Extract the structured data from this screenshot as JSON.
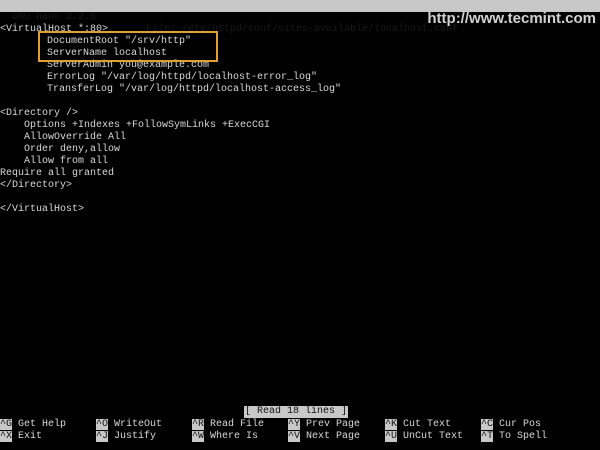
{
  "titlebar": {
    "app": "GNU nano 2.2.6",
    "file": "File: /etc/httpd/conf/sites-available/localhost.conf"
  },
  "watermark": "http://www.tecmint.com",
  "lines": [
    "<VirtualHost *:80>",
    "DocumentRoot \"/srv/http\"",
    "ServerName localhost",
    "ServerAdmin you@example.com",
    "ErrorLog \"/var/log/httpd/localhost-error_log\"",
    "TransferLog \"/var/log/httpd/localhost-access_log\"",
    "<Directory />",
    "Options +Indexes +FollowSymLinks +ExecCGI",
    "AllowOverride All",
    "Order deny,allow",
    "Allow from all",
    "Require all granted",
    "</Directory>",
    "</VirtualHost>"
  ],
  "status": "[ Read 18 lines ]",
  "shortcuts": [
    {
      "key": "^G",
      "label": "Get Help"
    },
    {
      "key": "^O",
      "label": "WriteOut"
    },
    {
      "key": "^R",
      "label": "Read File"
    },
    {
      "key": "^Y",
      "label": "Prev Page"
    },
    {
      "key": "^K",
      "label": "Cut Text"
    },
    {
      "key": "^C",
      "label": "Cur Pos"
    },
    {
      "key": "^X",
      "label": "Exit"
    },
    {
      "key": "^J",
      "label": "Justify"
    },
    {
      "key": "^W",
      "label": "Where Is"
    },
    {
      "key": "^V",
      "label": "Next Page"
    },
    {
      "key": "^U",
      "label": "UnCut Text"
    },
    {
      "key": "^T",
      "label": "To Spell"
    }
  ],
  "colors": {
    "highlight": "#e0a030"
  }
}
